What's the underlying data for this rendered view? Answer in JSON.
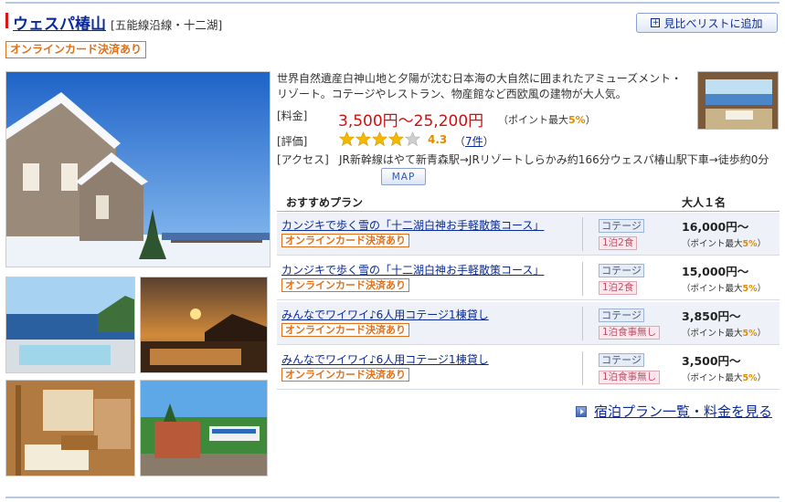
{
  "hotel": {
    "name": "ウェスパ椿山",
    "area": "[五能線沿線・十二湖]",
    "card_badge": "オンラインカード決済あり",
    "compare_button": "見比べリストに追加",
    "description": "世界自然遺産白神山地と夕陽が沈む日本海の大自然に囲まれたアミューズメント・リゾート。コテージやレストラン、物産館など西欧風の建物が大人気。"
  },
  "info": {
    "price_label": "[料金]",
    "price": "3,500円～25,200円",
    "points_prefix": "（ポイント最大",
    "points_value": "5%",
    "points_suffix": "）",
    "rating_label": "[評価]",
    "rating_stars": 4,
    "rating_score": "4.3",
    "review_open": "（",
    "review_count": "7件",
    "review_close": "）",
    "access_label": "[アクセス]",
    "access": "JR新幹線はやて新青森駅→JRリゾートしらかみ約166分ウェスパ椿山駅下車→徒歩約0分",
    "map_button": "MAP"
  },
  "plans": {
    "header_plan": "おすすめプラン",
    "header_price": "大人１名",
    "items": [
      {
        "title": "カンジキで歩く雪の「十二湖白神お手軽散策コース」",
        "badge": "オンラインカード決済あり",
        "room": "コテージ",
        "meal": "1泊2食",
        "price": "16,000円～",
        "points_prefix": "（ポイント最大",
        "points_value": "5%",
        "points_suffix": "）"
      },
      {
        "title": "カンジキで歩く雪の「十二湖白神お手軽散策コース」",
        "badge": "オンラインカード決済あり",
        "room": "コテージ",
        "meal": "1泊2食",
        "price": "15,000円～",
        "points_prefix": "（ポイント最大",
        "points_value": "5%",
        "points_suffix": "）"
      },
      {
        "title": "みんなでワイワイ♪6人用コテージ1棟貸し",
        "badge": "オンラインカード決済あり",
        "room": "コテージ",
        "meal": "1泊食事無し",
        "price": "3,850円～",
        "points_prefix": "（ポイント最大",
        "points_value": "5%",
        "points_suffix": "）"
      },
      {
        "title": "みんなでワイワイ♪6人用コテージ1棟貸し",
        "badge": "オンラインカード決済あり",
        "room": "コテージ",
        "meal": "1泊食事無し",
        "price": "3,500円～",
        "points_prefix": "（ポイント最大",
        "points_value": "5%",
        "points_suffix": "）"
      }
    ],
    "more_link": "宿泊プラン一覧・料金を見る"
  },
  "colors": {
    "link": "#0a2a9a",
    "price": "#cc1111",
    "badge": "#e0701a",
    "star": "#f5b800"
  }
}
